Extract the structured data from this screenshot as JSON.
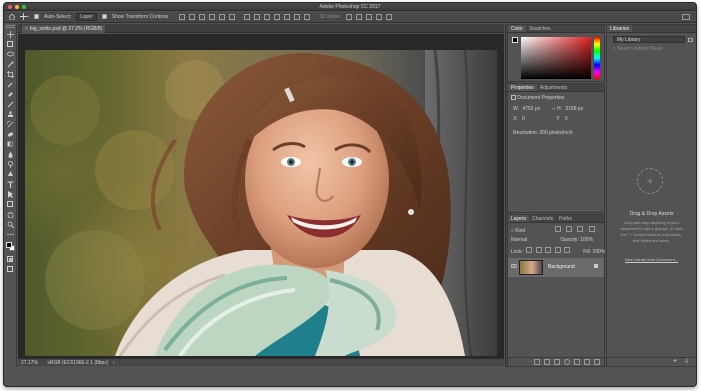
{
  "app": {
    "title": "Adobe Photoshop CC 2017"
  },
  "options_bar": {
    "auto_select_label": "Auto-Select:",
    "auto_select_value": "Layer",
    "transform_label": "Show Transform Controls",
    "mode_3d_label": "3D Mode:"
  },
  "document": {
    "tab_label": "big_smile.psd @ 27.2% (RGB/8)",
    "zoom": "27.17%",
    "color_profile": "sRGB IEC61966-2.1 (8bpc)"
  },
  "color_panel": {
    "tabs": [
      "Color",
      "Swatches"
    ]
  },
  "properties_panel": {
    "tabs": [
      "Properties",
      "Adjustments"
    ],
    "heading": "Document Properties",
    "w_label": "W:",
    "w_value": "4752 px",
    "h_label": "H:",
    "h_value": "3168 px",
    "x_label": "X:",
    "x_value": "0",
    "y_label": "Y:",
    "y_value": "0",
    "resolution": "Resolution: 300 pixels/inch"
  },
  "layers_panel": {
    "tabs": [
      "Layers",
      "Channels",
      "Paths"
    ],
    "filter_label": "Kind",
    "blend_mode": "Normal",
    "opacity_label": "Opacity:",
    "opacity_value": "100%",
    "lock_label": "Lock:",
    "fill_label": "Fill:",
    "fill_value": "100%",
    "layer_name": "Background",
    "footer_icons": [
      "link-icon",
      "fx-icon",
      "mask-icon",
      "adjustment-icon",
      "folder-icon",
      "new-layer-icon",
      "trash-icon"
    ]
  },
  "libraries_panel": {
    "tab": "Libraries",
    "library_name": "My Library",
    "search_placeholder": "Search Adobe Stock",
    "drop_title": "Drag & Drop Assets",
    "drop_text_1": "Drag and drop anything in your",
    "drop_text_2": "document to add a graphic, or click",
    "drop_text_3": "the \"+\" button below to add colors,",
    "drop_text_4": "text styles and more.",
    "new_library_link": "New Library from Document..."
  },
  "colors": {
    "accent": "#2d8ceb",
    "panel_bg": "#535353",
    "canvas_bg": "#282828"
  }
}
